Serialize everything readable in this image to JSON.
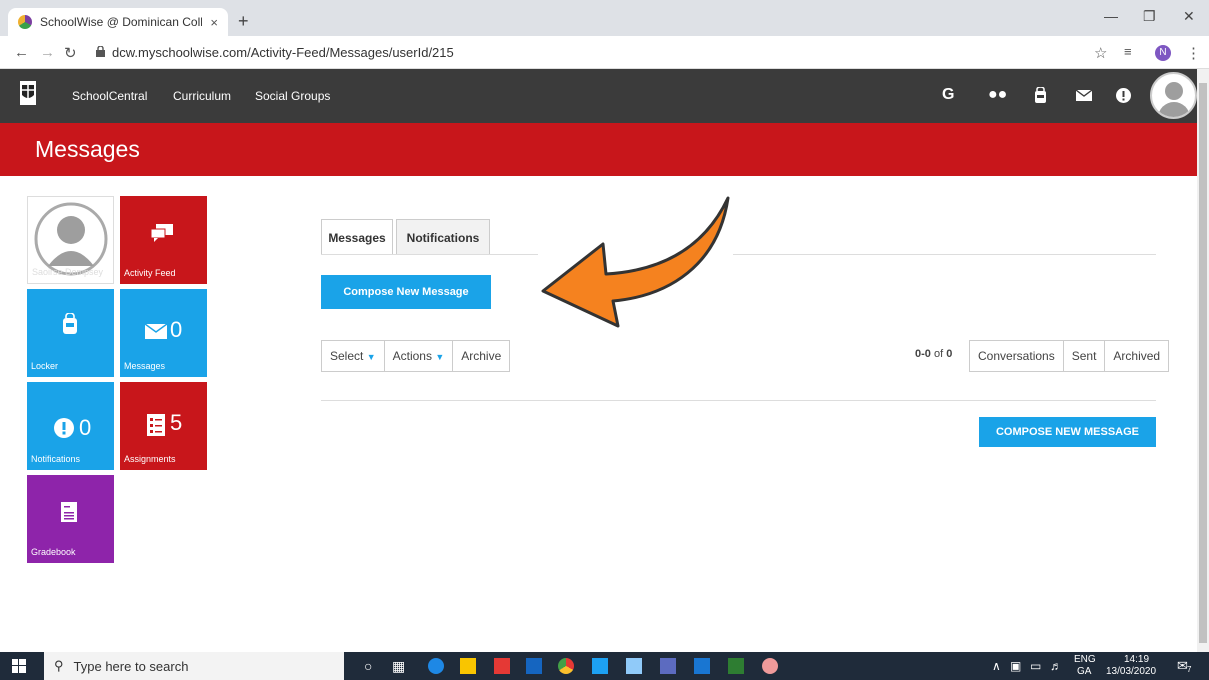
{
  "browser": {
    "tab_title": "SchoolWise @ Dominican Colleg",
    "tab_close": "×",
    "new_tab": "+",
    "url": "dcw.myschoolwise.com/Activity-Feed/Messages/userId/215",
    "profile_initial": "N"
  },
  "nav": {
    "links": [
      "SchoolCentral",
      "Curriculum",
      "Social Groups"
    ],
    "icons": [
      "google-icon",
      "users-icon",
      "locker-icon",
      "mail-icon",
      "alert-icon"
    ]
  },
  "header": {
    "title": "Messages"
  },
  "tiles": {
    "profile": {
      "label": "Saoirse Dempsey"
    },
    "activity": {
      "label": "Activity Feed"
    },
    "locker": {
      "label": "Locker"
    },
    "messages": {
      "label": "Messages",
      "count": "0"
    },
    "notifications": {
      "label": "Notifications",
      "count": "0"
    },
    "assignments": {
      "label": "Assignments",
      "count": "5"
    },
    "gradebook": {
      "label": "Gradebook"
    }
  },
  "main": {
    "tabs": [
      "Messages",
      "Notifications"
    ],
    "compose_label": "Compose New Message",
    "toolbar": {
      "select": "Select",
      "actions": "Actions",
      "archive": "Archive"
    },
    "paging": {
      "range": "0-0",
      "of": "of",
      "total": "0"
    },
    "filters": [
      "Conversations",
      "Sent",
      "Archived"
    ],
    "compose_upper": "COMPOSE NEW MESSAGE"
  },
  "taskbar": {
    "search_placeholder": "Type here to search",
    "lang": "ENG",
    "region": "GA",
    "time": "14:19",
    "date": "13/03/2020",
    "notif_count": "7"
  },
  "colors": {
    "red": "#c8161b",
    "blue": "#1aa3e8",
    "purple": "#8e24aa",
    "dark": "#3b3b3b",
    "arrow": "#f5821f"
  }
}
